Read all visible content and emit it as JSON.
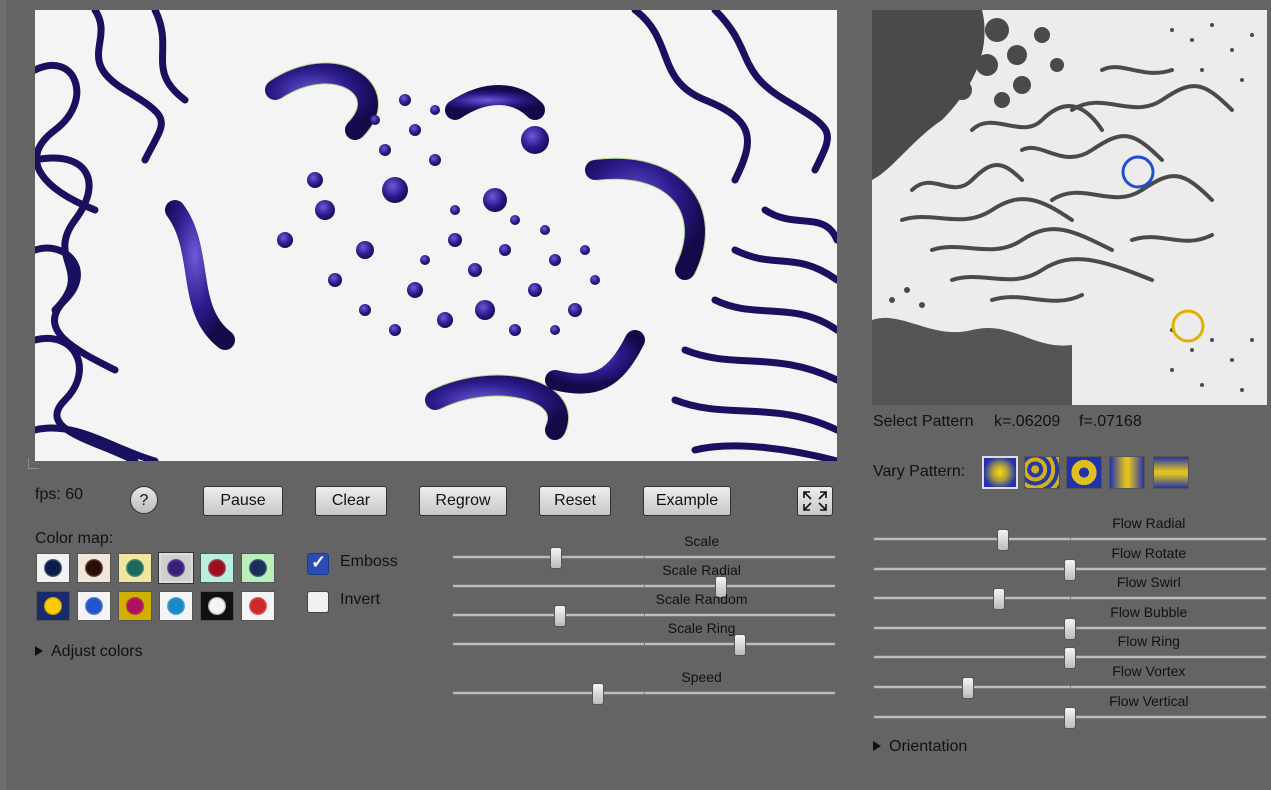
{
  "fps_label": "fps: 60",
  "help_label": "?",
  "buttons": {
    "pause": "Pause",
    "clear": "Clear",
    "regrow": "Regrow",
    "reset": "Reset",
    "example": "Example"
  },
  "colormap": {
    "label": "Color map:",
    "swatches": [
      {
        "bg": "#f2f2f2",
        "dot": "#0d1b4a"
      },
      {
        "bg": "#f2e6d8",
        "dot": "#2a0f08"
      },
      {
        "bg": "#efe6a0",
        "dot": "#1c6b5a"
      },
      {
        "bg": "#cfcfcf",
        "dot": "#3a1f7a",
        "selected": true
      },
      {
        "bg": "#b9efe0",
        "dot": "#9a1020"
      },
      {
        "bg": "#b9f0b9",
        "dot": "#1a2e5a"
      },
      {
        "bg": "#1a2a6a",
        "dot": "#ffcc00"
      },
      {
        "bg": "#f4f4f4",
        "dot": "#2255cc"
      },
      {
        "bg": "#d0b000",
        "dot": "#b01060"
      },
      {
        "bg": "#f4f4f4",
        "dot": "#1888c8"
      },
      {
        "bg": "#111111",
        "dot": "#f4f4f4"
      },
      {
        "bg": "#f4f4f4",
        "dot": "#cc2a2a"
      }
    ]
  },
  "emboss": {
    "label": "Emboss",
    "checked": true
  },
  "invert": {
    "label": "Invert",
    "checked": false
  },
  "adjust_colors": "Adjust colors",
  "left_sliders": [
    {
      "label": "Scale",
      "value": 0.27
    },
    {
      "label": "Scale Radial",
      "value": 0.7
    },
    {
      "label": "Scale Random",
      "value": 0.28
    },
    {
      "label": "Scale Ring",
      "value": 0.75
    },
    {
      "label": "Speed",
      "value": 0.38
    }
  ],
  "select_pattern": {
    "label": "Select Pattern",
    "k": "k=.06209",
    "f": "f=.07168"
  },
  "vary_pattern": {
    "label": "Vary Pattern:"
  },
  "right_sliders": [
    {
      "label": "Flow Radial",
      "value": 0.33
    },
    {
      "label": "Flow Rotate",
      "value": 0.5
    },
    {
      "label": "Flow Swirl",
      "value": 0.32
    },
    {
      "label": "Flow Bubble",
      "value": 0.5
    },
    {
      "label": "Flow Ring",
      "value": 0.5
    },
    {
      "label": "Flow Vortex",
      "value": 0.24
    },
    {
      "label": "Flow Vertical",
      "value": 0.5
    }
  ],
  "orientation": "Orientation",
  "colors": {
    "accent": "#2a4db3",
    "marker_blue": "#1f4fd6",
    "marker_yellow": "#e0b000",
    "blob": "#2b1a8a",
    "halo": "#7fc23a"
  }
}
